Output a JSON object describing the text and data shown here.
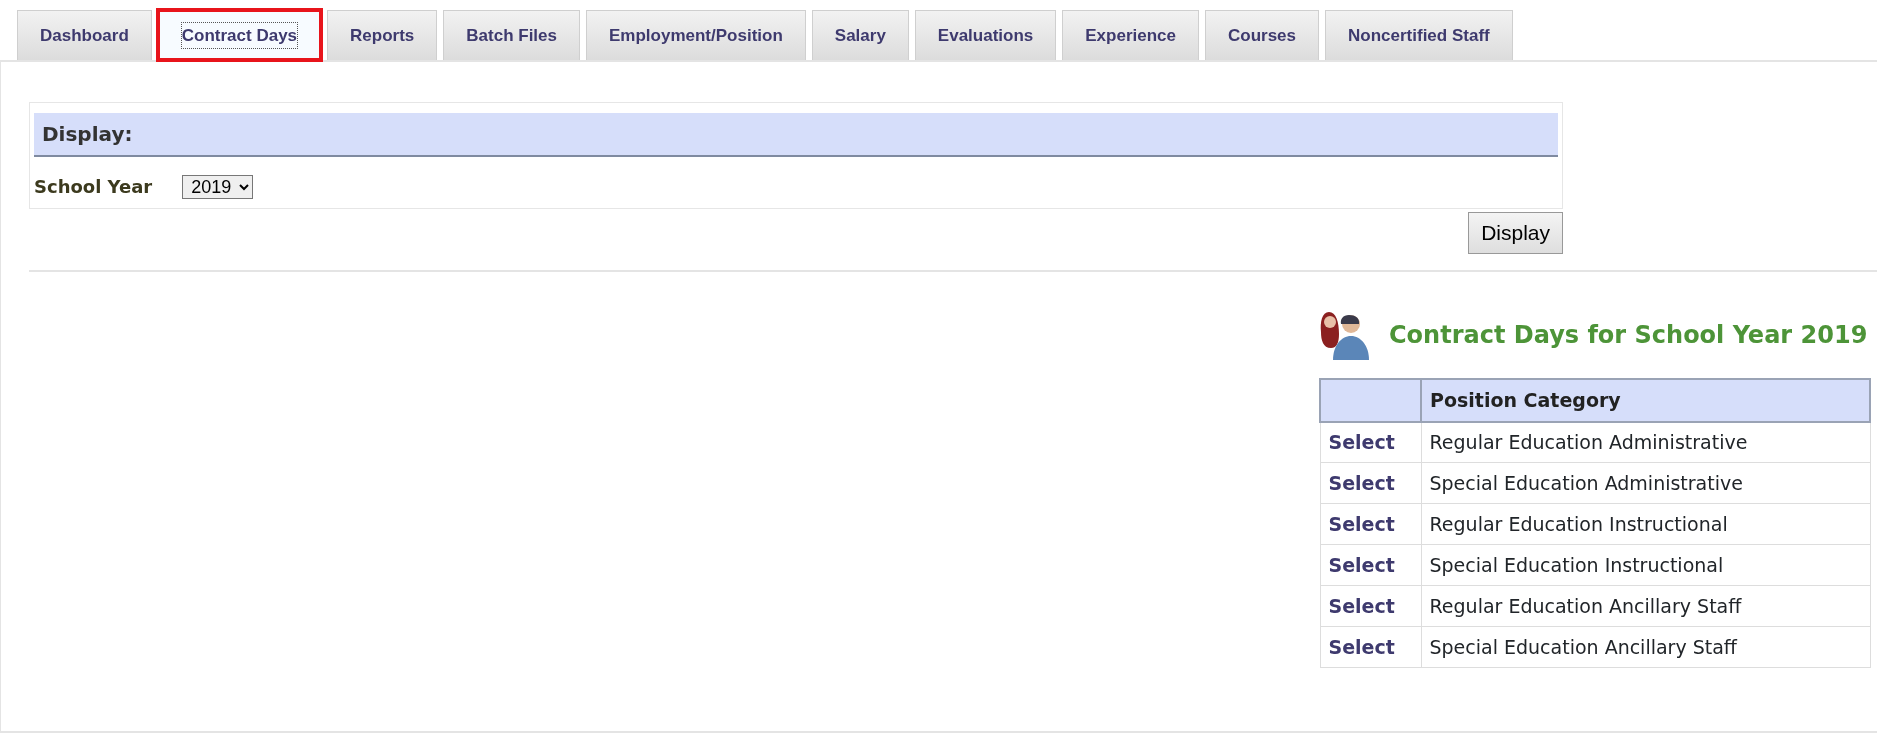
{
  "tabs": [
    {
      "label": "Dashboard",
      "selected": false,
      "highlighted": false
    },
    {
      "label": "Contract Days",
      "selected": true,
      "highlighted": true
    },
    {
      "label": "Reports",
      "selected": false,
      "highlighted": false
    },
    {
      "label": "Batch Files",
      "selected": false,
      "highlighted": false
    },
    {
      "label": "Employment/Position",
      "selected": false,
      "highlighted": false
    },
    {
      "label": "Salary",
      "selected": false,
      "highlighted": false
    },
    {
      "label": "Evaluations",
      "selected": false,
      "highlighted": false
    },
    {
      "label": "Experience",
      "selected": false,
      "highlighted": false
    },
    {
      "label": "Courses",
      "selected": false,
      "highlighted": false
    },
    {
      "label": "Noncertified Staff",
      "selected": false,
      "highlighted": false
    }
  ],
  "display_panel": {
    "header": "Display:",
    "school_year_label": "School Year",
    "school_year_value": "2019",
    "button": "Display"
  },
  "results": {
    "title": "Contract Days for School Year 2019",
    "table": {
      "columns": [
        "",
        "Position Category"
      ],
      "rows": [
        {
          "action": "Select",
          "category": "Regular Education Administrative"
        },
        {
          "action": "Select",
          "category": "Special Education Administrative"
        },
        {
          "action": "Select",
          "category": "Regular Education Instructional"
        },
        {
          "action": "Select",
          "category": "Special Education Instructional"
        },
        {
          "action": "Select",
          "category": "Regular Education Ancillary Staff"
        },
        {
          "action": "Select",
          "category": "Special Education Ancillary Staff"
        }
      ]
    }
  }
}
